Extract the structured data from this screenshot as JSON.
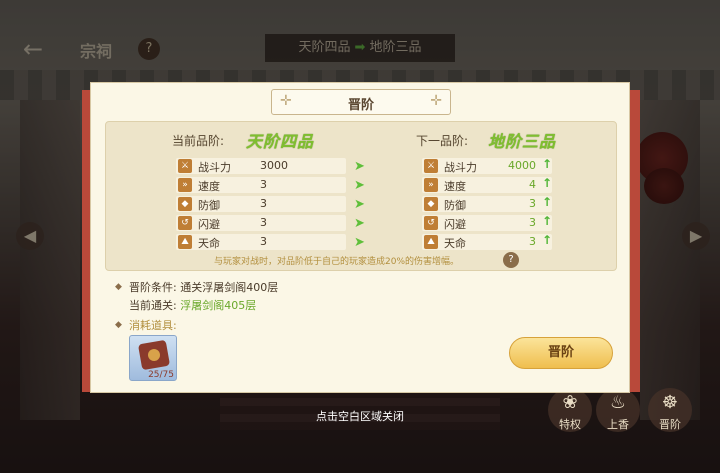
{
  "top_bar": {
    "title": "宗祠",
    "help_glyph": "?",
    "rank_from": "天阶四品",
    "rank_to": "地阶三品",
    "back_glyph": "←"
  },
  "side_nav": {
    "left_glyph": "◀",
    "right_glyph": "▶"
  },
  "dialog": {
    "title": "晋阶",
    "current_rank_label": "当前品阶:",
    "current_rank_value": "天阶四品",
    "next_rank_label": "下一品阶:",
    "next_rank_value": "地阶三品",
    "stats": [
      {
        "name": "战斗力",
        "icon": "sword-icon",
        "glyph": "⚔",
        "current": "3000",
        "next": "4000"
      },
      {
        "name": "速度",
        "icon": "boot-icon",
        "glyph": "»",
        "current": "3",
        "next": "4"
      },
      {
        "name": "防御",
        "icon": "shield-icon",
        "glyph": "◆",
        "current": "3",
        "next": "3"
      },
      {
        "name": "闪避",
        "icon": "dodge-icon",
        "glyph": "↺",
        "current": "3",
        "next": "3"
      },
      {
        "name": "天命",
        "icon": "fate-icon",
        "glyph": "⛰",
        "current": "3",
        "next": "3"
      }
    ],
    "note": "与玩家对战时，对品阶低于自己的玩家造成20%的伤害增幅。",
    "note_help_glyph": "?",
    "condition_label": "晋阶条件:",
    "condition_value": "通关浮屠剑阁400层",
    "cleared_label": "当前通关:",
    "cleared_value": "浮屠剑阁405层",
    "consume_label": "消耗道具:",
    "item_count": "25/75",
    "advance_button": "晋阶"
  },
  "bottom_buttons": [
    {
      "label": "特权",
      "glyph": "❀"
    },
    {
      "label": "上香",
      "glyph": "♨"
    },
    {
      "label": "晋阶",
      "glyph": "☸"
    }
  ],
  "close_hint": "点击空白区域关闭",
  "colors": {
    "accent_green": "#69a82a",
    "ribbon_red": "#b9493a",
    "button_gold": "#efbe4e"
  }
}
